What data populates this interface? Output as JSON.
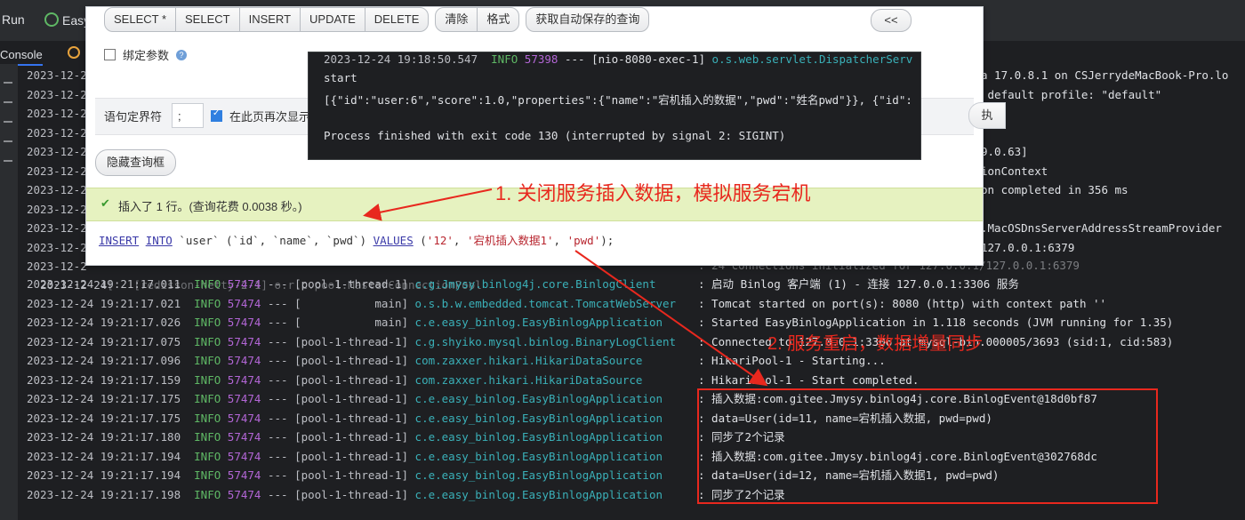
{
  "ide": {
    "run_label": "Run",
    "app_tab": "Easy",
    "console_tab": "Console"
  },
  "upper_log_lines": [
    {
      "ts": "2023-12-2",
      "tail": "a 17.0.8.1 on CSJerrydeMacBook-Pro.lo"
    },
    {
      "ts": "2023-12-2",
      "tail": " default profile: \"default\""
    },
    {
      "ts": "2023-12-2",
      "tail": "ttp)"
    },
    {
      "ts": "2023-12-2",
      "tail": ""
    },
    {
      "ts": "2023-12-2",
      "tail": "9.0.63]"
    },
    {
      "ts": "2023-12-2",
      "tail": "ionContext"
    },
    {
      "ts": "2023-12-2",
      "tail": "on completed in 356 ms"
    },
    {
      "ts": "2023-12-2",
      "tail": ""
    },
    {
      "ts": "2023-12-2",
      "tail": ".MacOSDnsServerAddressStreamProvider"
    },
    {
      "ts": "2023-12-2",
      "tail": "127.0.0.1:6379"
    },
    {
      "ts": "2023-12-2",
      "tail": ""
    }
  ],
  "obscured_line": {
    "ts": "2023-12-24",
    "middle": "[   [redisson-netty-2-1] o.r.c.pool.MasterConnectionPool",
    "msg": ": 24 connections initialized for 127.0.0.1/127.0.0.1:6379"
  },
  "log_lines": [
    {
      "ts": "2023-12-24 19:21:17.011",
      "level": "INFO",
      "pid": "57474",
      "sep": "---",
      "thread": "[pool-1-thread-1]",
      "logger": "c.g.Jmysy.binlog4j.core.BinlogClient",
      "msg": ": 启动 Binlog 客户端 (1) - 连接 127.0.0.1:3306 服务"
    },
    {
      "ts": "2023-12-24 19:21:17.021",
      "level": "INFO",
      "pid": "57474",
      "sep": "---",
      "thread": "[           main]",
      "logger": "o.s.b.w.embedded.tomcat.TomcatWebServer",
      "msg": ": Tomcat started on port(s): 8080 (http) with context path ''"
    },
    {
      "ts": "2023-12-24 19:21:17.026",
      "level": "INFO",
      "pid": "57474",
      "sep": "---",
      "thread": "[           main]",
      "logger": "c.e.easy_binlog.EasyBinlogApplication",
      "msg": ": Started EasyBinlogApplication in 1.118 seconds (JVM running for 1.35)"
    },
    {
      "ts": "2023-12-24 19:21:17.075",
      "level": "INFO",
      "pid": "57474",
      "sep": "---",
      "thread": "[pool-1-thread-1]",
      "logger": "c.g.shyiko.mysql.binlog.BinaryLogClient",
      "msg": ": Connected to 127.0.0.1:3306 at mysql-bin.000005/3693 (sid:1, cid:583)"
    },
    {
      "ts": "2023-12-24 19:21:17.096",
      "level": "INFO",
      "pid": "57474",
      "sep": "---",
      "thread": "[pool-1-thread-1]",
      "logger": "com.zaxxer.hikari.HikariDataSource",
      "msg": ": HikariPool-1 - Starting..."
    },
    {
      "ts": "2023-12-24 19:21:17.159",
      "level": "INFO",
      "pid": "57474",
      "sep": "---",
      "thread": "[pool-1-thread-1]",
      "logger": "com.zaxxer.hikari.HikariDataSource",
      "msg": ": HikariPool-1 - Start completed."
    },
    {
      "ts": "2023-12-24 19:21:17.175",
      "level": "INFO",
      "pid": "57474",
      "sep": "---",
      "thread": "[pool-1-thread-1]",
      "logger": "c.e.easy_binlog.EasyBinlogApplication",
      "msg": ": 插入数据:com.gitee.Jmysy.binlog4j.core.BinlogEvent@18d0bf87"
    },
    {
      "ts": "2023-12-24 19:21:17.175",
      "level": "INFO",
      "pid": "57474",
      "sep": "---",
      "thread": "[pool-1-thread-1]",
      "logger": "c.e.easy_binlog.EasyBinlogApplication",
      "msg": ": data=User(id=11, name=宕机插入数据, pwd=pwd)"
    },
    {
      "ts": "2023-12-24 19:21:17.180",
      "level": "INFO",
      "pid": "57474",
      "sep": "---",
      "thread": "[pool-1-thread-1]",
      "logger": "c.e.easy_binlog.EasyBinlogApplication",
      "msg": ": 同步了2个记录"
    },
    {
      "ts": "2023-12-24 19:21:17.194",
      "level": "INFO",
      "pid": "57474",
      "sep": "---",
      "thread": "[pool-1-thread-1]",
      "logger": "c.e.easy_binlog.EasyBinlogApplication",
      "msg": ": 插入数据:com.gitee.Jmysy.binlog4j.core.BinlogEvent@302768dc"
    },
    {
      "ts": "2023-12-24 19:21:17.194",
      "level": "INFO",
      "pid": "57474",
      "sep": "---",
      "thread": "[pool-1-thread-1]",
      "logger": "c.e.easy_binlog.EasyBinlogApplication",
      "msg": ": data=User(id=12, name=宕机插入数据1, pwd=pwd)"
    },
    {
      "ts": "2023-12-24 19:21:17.198",
      "level": "INFO",
      "pid": "57474",
      "sep": "---",
      "thread": "[pool-1-thread-1]",
      "logger": "c.e.easy_binlog.EasyBinlogApplication",
      "msg": ": 同步了2个记录"
    }
  ],
  "sql_panel": {
    "buttons": [
      "SELECT *",
      "SELECT",
      "INSERT",
      "UPDATE",
      "DELETE"
    ],
    "clear_label": "清除",
    "format_label": "格式",
    "autosave_label": "获取自动保存的查询",
    "collapse_label": "<<",
    "bind_params_label": "绑定参数",
    "help_icon": "?",
    "delimiter_label": "语句定界符",
    "delimiter_value": ";",
    "show_again_label": "在此页再次显示此",
    "exec_label": "执",
    "hide_query_label": "隐藏查询框",
    "result_text": "插入了 1 行。(查询花费 0.0038 秒。)",
    "sql_kw_insert": "INSERT",
    "sql_kw_into": "INTO",
    "sql_table": " `user` (`id`, `name`, `pwd`) ",
    "sql_kw_values": "VALUES",
    "sql_open": " (",
    "sql_v1": "'12'",
    "sql_comma1": ", ",
    "sql_v2": "'宕机插入数据1'",
    "sql_comma2": ", ",
    "sql_v3": "'pwd'",
    "sql_close": ");"
  },
  "terminal": {
    "line1_ts": "2023-12-24 19:18:50.547",
    "line1_level": "INFO",
    "line1_pid": "57398",
    "line1_sep": "--- [nio-8080-exec-1]",
    "line1_logger": "o.s.web.servlet.DispatcherServ",
    "line2": "start",
    "line3": "[{\"id\":\"user:6\",\"score\":1.0,\"properties\":{\"name\":\"宕机插入的数据\",\"pwd\":\"姓名pwd\"}}, {\"id\":",
    "line4": "Process finished with exit code 130 (interrupted by signal 2: SIGINT)"
  },
  "annotations": {
    "step1": "1. 关闭服务插入数据，模拟服务宕机",
    "step2": "2. 服务重启，数据增量同步",
    "color": "#e8281e"
  }
}
